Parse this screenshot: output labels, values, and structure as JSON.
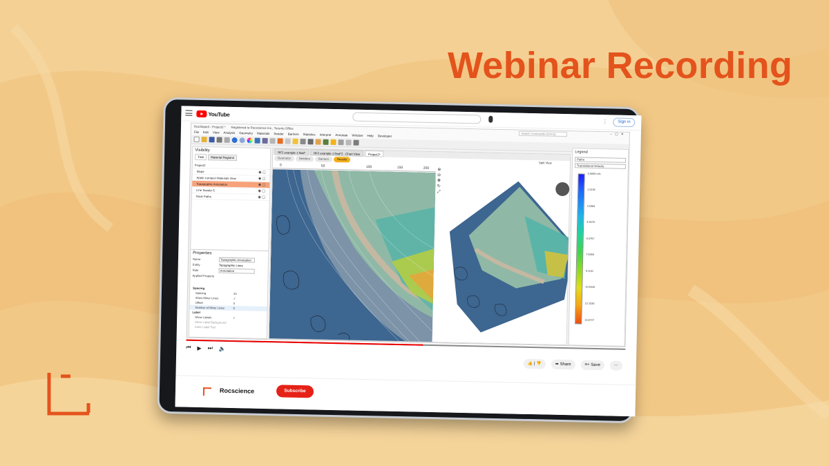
{
  "headline": "Webinar Recording",
  "colors": {
    "brand_orange": "#e4531c",
    "background": "#f2c886",
    "youtube_red": "#ff0000",
    "subscribe_red": "#e62117",
    "selected_row": "#f7a27a",
    "results_tab": "#f3b01b"
  },
  "youtube": {
    "logo_text": "YouTube",
    "sign_in": "Sign in",
    "channel_name": "Rocscience",
    "subscribe": "Subscribe",
    "share": "Share",
    "save": "Save",
    "progress_fraction": 0.54,
    "icons": [
      "menu-icon",
      "youtube-logo-icon",
      "mic-icon",
      "more-icon",
      "skip-back-icon",
      "play-icon",
      "skip-forward-icon",
      "volume-icon",
      "like-icon",
      "dislike-icon",
      "share-icon",
      "save-icon"
    ]
  },
  "app": {
    "title": "RocSlope3 - Project2 *",
    "registration": "Registered to Rocscience Inc., Toronto Office",
    "search_placeholder": "Search Commands (Ctrl+Q)",
    "menu": [
      "File",
      "Edit",
      "View",
      "Analysis",
      "Geometry",
      "Materials",
      "Seeder",
      "Barriers",
      "Statistics",
      "Interpret",
      "Annotate",
      "Window",
      "Help",
      "Developer"
    ],
    "left_pane": {
      "title": "Visibility",
      "tabs": [
        "Tree",
        "Material Regions"
      ],
      "project": "Project2",
      "tree": [
        {
          "label": "Slope",
          "selected": false
        },
        {
          "label": "Apply a project Materials View",
          "selected": false
        },
        {
          "label": "Topographic Annotation",
          "selected": true
        },
        {
          "label": "Line Seeder 5",
          "selected": false
        },
        {
          "label": "Rock Paths",
          "selected": false
        }
      ]
    },
    "properties": {
      "title": "Properties",
      "rows": [
        {
          "key": "Name",
          "value": "Topographic Annotation"
        },
        {
          "key": "Entity",
          "value": "Topographic Lines"
        },
        {
          "key": "Role",
          "value": "Annotation"
        },
        {
          "key": "Applied Property",
          "value": ""
        }
      ],
      "spacing_head": "Spacing",
      "spacing_rows": [
        {
          "key": "Spacing",
          "value": "20"
        },
        {
          "key": "Show Minor Lines",
          "value": "✓"
        },
        {
          "key": "Offset",
          "value": "0"
        },
        {
          "key": "Number of Minor Lines",
          "value": "5"
        }
      ],
      "label_head": "Label",
      "label_rows": [
        {
          "key": "Show Labels",
          "value": "✓"
        },
        {
          "key": "Show Label Background",
          "value": ""
        },
        {
          "key": "Color Label Text",
          "value": ""
        }
      ]
    },
    "doc_tabs": [
      "RF2 example 1 final*",
      "RF2 example 1 final*2 - Chart View",
      "Project2*"
    ],
    "stage_tabs": [
      "Geometry",
      "Seeders",
      "Barriers",
      "Results"
    ],
    "active_stage": "Results",
    "split_view": "Split View",
    "ruler_ticks": [
      "0",
      "50",
      "100",
      "150",
      "200"
    ],
    "legend": {
      "title": "Legend",
      "select_1": "Paths",
      "select_2": "Translational Velocity",
      "values": [
        "0.0000 m/s",
        "1.5192",
        "3.0384",
        "4.5576",
        "6.0767",
        "7.5959",
        "9.1151",
        "10.6343",
        "12.1535",
        "13.6727"
      ]
    }
  }
}
